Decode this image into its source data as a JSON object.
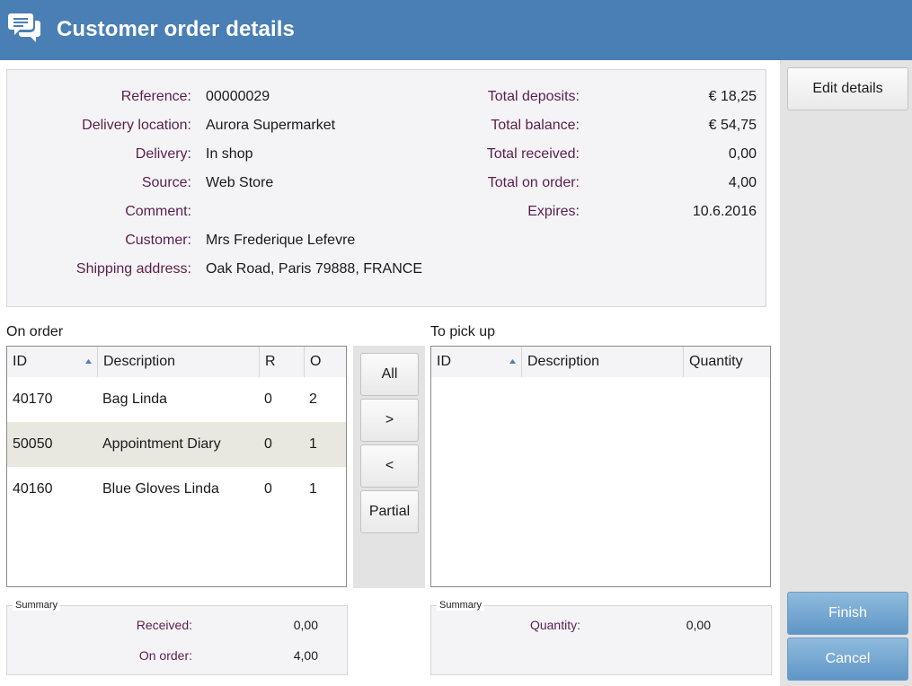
{
  "window": {
    "title": "Customer order details",
    "icon": "chat-bubbles-icon",
    "accent_color": "#4a7fb5"
  },
  "details": {
    "left": [
      {
        "label": "Reference:",
        "value": "00000029"
      },
      {
        "label": "Delivery location:",
        "value": "Aurora Supermarket"
      },
      {
        "label": "Delivery:",
        "value": "In shop"
      },
      {
        "label": "Source:",
        "value": "Web Store"
      },
      {
        "label": "Comment:",
        "value": ""
      },
      {
        "label": "Customer:",
        "value": "Mrs Frederique Lefevre"
      },
      {
        "label": "Shipping address:",
        "value": "Oak Road, Paris 79888, FRANCE"
      }
    ],
    "right": [
      {
        "label": "Total deposits:",
        "value": "€ 18,25"
      },
      {
        "label": "Total balance:",
        "value": "€ 54,75"
      },
      {
        "label": "Total received:",
        "value": "0,00"
      },
      {
        "label": "Total on order:",
        "value": "4,00"
      },
      {
        "label": "Expires:",
        "value": "10.6.2016"
      }
    ]
  },
  "on_order": {
    "title": "On order",
    "columns": [
      "ID",
      "Description",
      "R",
      "O"
    ],
    "sort_column": "ID",
    "rows": [
      {
        "id": "40170",
        "description": "Bag Linda",
        "r": "0",
        "o": "2",
        "selected": false
      },
      {
        "id": "50050",
        "description": "Appointment Diary",
        "r": "0",
        "o": "1",
        "selected": true
      },
      {
        "id": "40160",
        "description": "Blue Gloves Linda",
        "r": "0",
        "o": "1",
        "selected": false
      }
    ]
  },
  "to_pick_up": {
    "title": "To pick up",
    "columns": [
      "ID",
      "Description",
      "Quantity"
    ],
    "sort_column": "ID",
    "rows": []
  },
  "move_buttons": {
    "all": "All",
    "add": ">",
    "remove": "<",
    "partial": "Partial"
  },
  "summary_left": {
    "legend": "Summary",
    "received_label": "Received:",
    "received_value": "0,00",
    "on_order_label": "On order:",
    "on_order_value": "4,00"
  },
  "summary_right": {
    "legend": "Summary",
    "quantity_label": "Quantity:",
    "quantity_value": "0,00"
  },
  "actions": {
    "edit_details": "Edit details",
    "finish": "Finish",
    "cancel": "Cancel"
  }
}
